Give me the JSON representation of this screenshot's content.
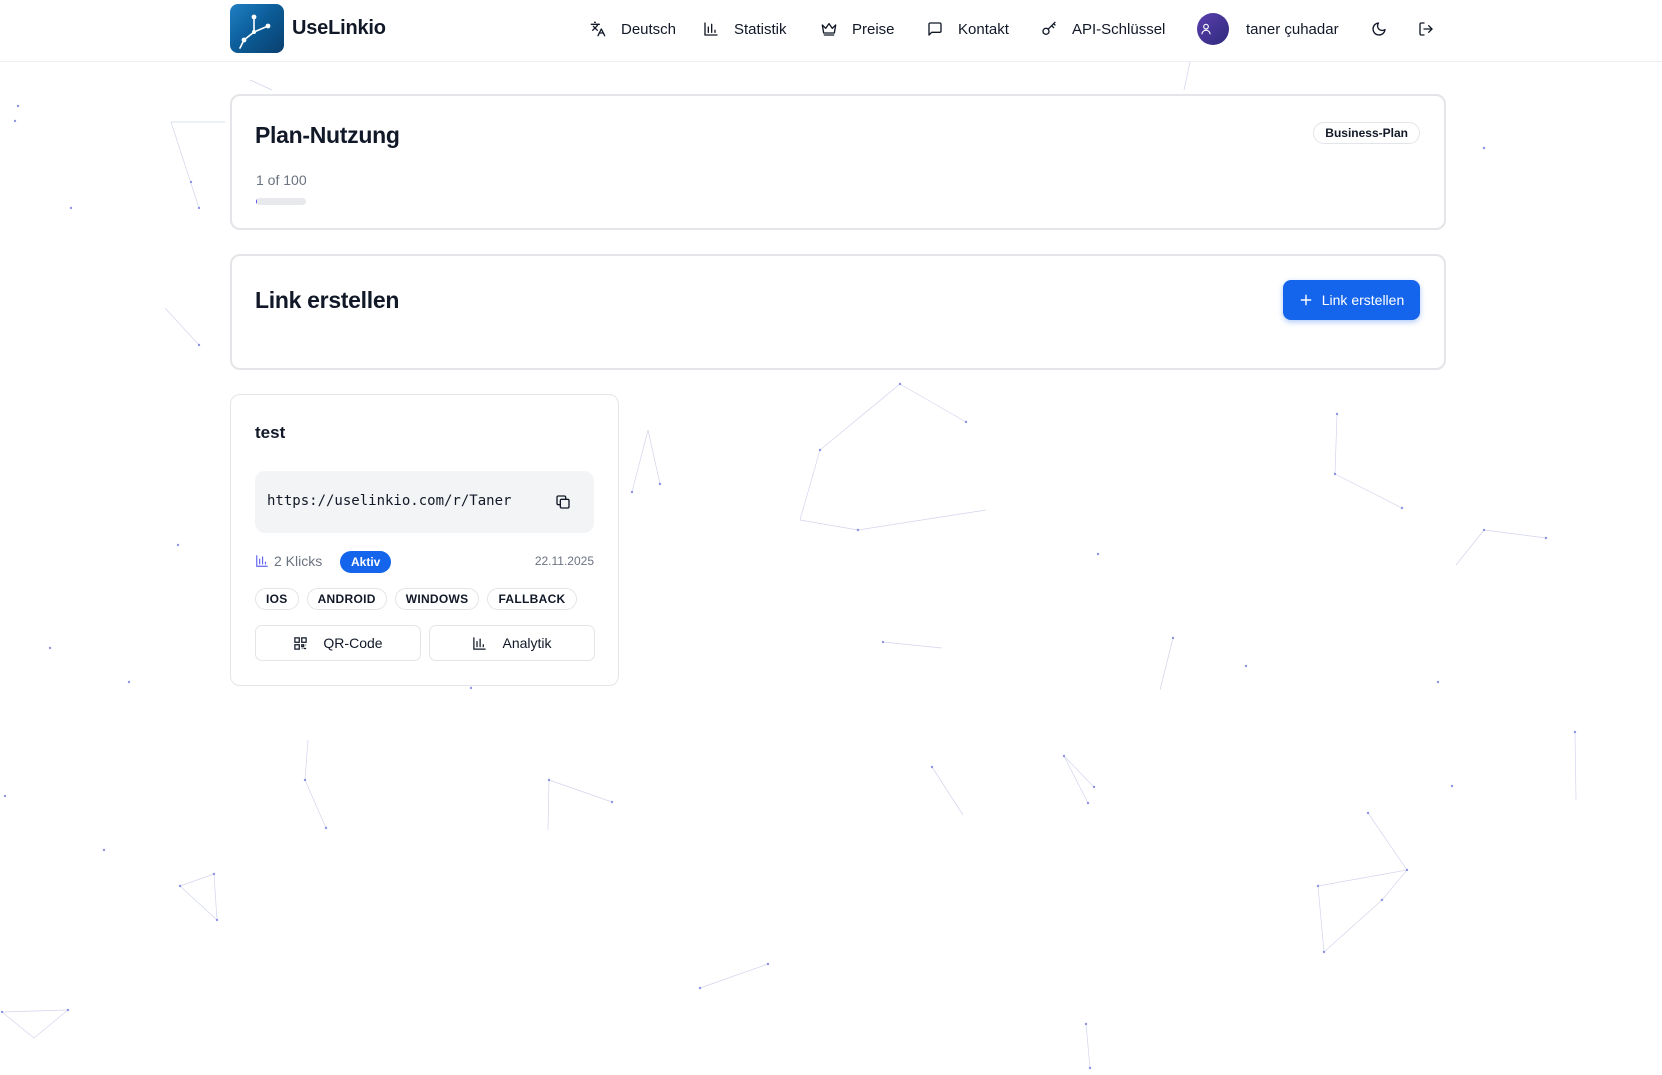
{
  "header": {
    "brand_name": "UseLinkio",
    "nav": [
      {
        "label": "Deutsch",
        "icon": "translate-icon"
      },
      {
        "label": "Statistik",
        "icon": "bar-chart-icon"
      },
      {
        "label": "Preise",
        "icon": "crown-icon"
      },
      {
        "label": "Kontakt",
        "icon": "message-icon"
      },
      {
        "label": "API-Schlüssel",
        "icon": "key-icon"
      }
    ],
    "user_name": "taner çuhadar",
    "theme_icon": "moon-icon",
    "logout_icon": "logout-icon"
  },
  "plan": {
    "title": "Plan-Nutzung",
    "badge": "Business-Plan",
    "usage_text": "1 of 100",
    "usage_fraction": 0.01
  },
  "create": {
    "title": "Link erstellen",
    "button_label": "Link erstellen"
  },
  "links": [
    {
      "name": "test",
      "url": "https://uselinkio.com/r/Taner",
      "clicks": "2 Klicks",
      "status": "Aktiv",
      "date": "22.11.2025",
      "platforms": [
        "IOS",
        "ANDROID",
        "WINDOWS",
        "FALLBACK"
      ],
      "qr_label": "QR-Code",
      "analytics_label": "Analytik"
    }
  ],
  "colors": {
    "accent": "#1565ec",
    "progress": "#4f46e5",
    "border": "#e3e5e8",
    "muted_text": "#6b7280"
  }
}
